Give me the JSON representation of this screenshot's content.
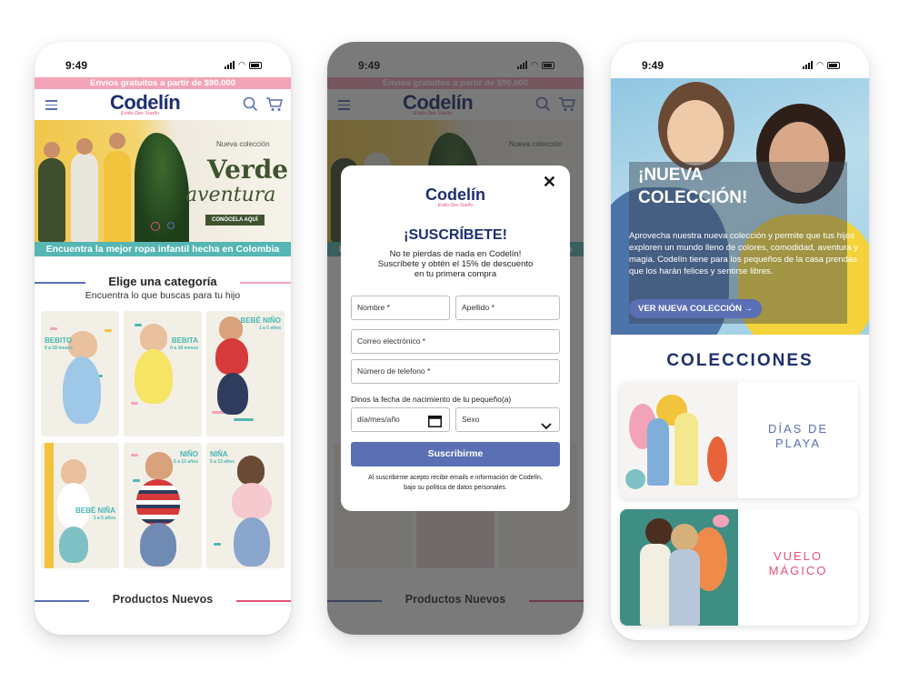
{
  "status": {
    "time": "9:49"
  },
  "colors": {
    "pink": "#f3a3b7",
    "navy": "#1e2f6f",
    "blue": "#5b6fb5",
    "teal": "#55b6b4",
    "magenta": "#e4517a"
  },
  "home": {
    "promo": "Envios gratuitos a partir de $90.000",
    "logo": "Codelín",
    "logo_tagline": "Estilo Des Sueño",
    "hero": {
      "small": "Nueva colección",
      "line1": "Verde",
      "line2": "aventura",
      "button": "CONÓCELA AQUÍ"
    },
    "strip": "Encuentra la mejor ropa infantil hecha en Colombia",
    "category_title": "Elige una categoría",
    "category_subtitle": "Encuentra lo que buscas para tu hijo",
    "categories": [
      {
        "label": "BEBITO",
        "age": "0 a 18 meses"
      },
      {
        "label": "BEBITA",
        "age": "0 a 18 meses"
      },
      {
        "label": "BEBÉ NIÑO",
        "age": "1 a 5 años"
      },
      {
        "label": "BEBÉ NIÑA",
        "age": "1 a 5 años"
      },
      {
        "label": "NIÑO",
        "age": "5 a 13 años"
      },
      {
        "label": "NIÑA",
        "age": "5 a 13 años"
      }
    ],
    "products_title": "Productos Nuevos"
  },
  "modal": {
    "logo": "Codelín",
    "logo_tagline": "Estilo Des Sueño",
    "title": "¡SUSCRÍBETE!",
    "text1": "No te pierdas de nada en Codelín!",
    "text2": "Suscríbete y obtén el 15% de descuento",
    "text3": "en tu primera compra",
    "fields": {
      "first_name": "Nombre *",
      "last_name": "Apellido *",
      "email": "Correo electrónico *",
      "phone": "Número de telefono *"
    },
    "dob_label": "Dinos la fecha de nacimiento de tu pequeño(a)",
    "date_placeholder": "día/mes/año",
    "sex_select": "Sexo",
    "submit": "Suscribirme",
    "legal1": "Al suscribirme acepto recibir emails e información de Codelín,",
    "legal2": "bajo su política de datos personales."
  },
  "collection": {
    "title_line1": "¡NUEVA",
    "title_line2": "COLECCIÓN!",
    "text": "Aprovecha nuestra nueva colección y permite que tus hijos exploren un mundo lleno de colores, comodidad, aventura y magia. Codelín tiene para los pequeños de la casa prendas que los harán felices y sentirse libres.",
    "button": "VER NUEVA COLECCIÓN  →",
    "collections_title": "COLECCIONES",
    "cards": [
      {
        "name1": "DÍAS DE",
        "name2": "PLAYA",
        "color": "#5b6fb5"
      },
      {
        "name1": "VUELO",
        "name2": "MÁGICO",
        "color": "#e4517a"
      }
    ]
  }
}
